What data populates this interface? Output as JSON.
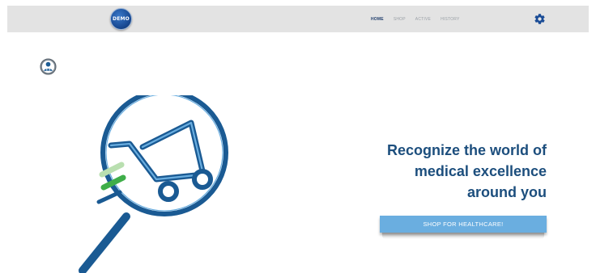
{
  "header": {
    "logo_text": "DEMO",
    "nav": [
      {
        "label": "HOME",
        "active": true
      },
      {
        "label": "SHOP",
        "active": false
      },
      {
        "label": "ACTIVE",
        "active": false
      },
      {
        "label": "HISTORY",
        "active": false
      }
    ],
    "settings_icon": "gear-icon"
  },
  "profile": {
    "icon": "user-avatar-icon"
  },
  "hero": {
    "illustration": "magnifier-cart-icon",
    "headline_lines": [
      "Recognize the world of",
      "medical excellence",
      "around you"
    ],
    "cta_label": "SHOP FOR HEALTHCARE!"
  },
  "colors": {
    "topbar": "#e3e3e3",
    "brand_blue": "#1a4c96",
    "headline": "#1c4e7d",
    "cta": "#6aaee0",
    "illustration_blue": "#1f5e96",
    "accent_green": "#3fae49",
    "accent_light_green": "#b9dfb0"
  }
}
